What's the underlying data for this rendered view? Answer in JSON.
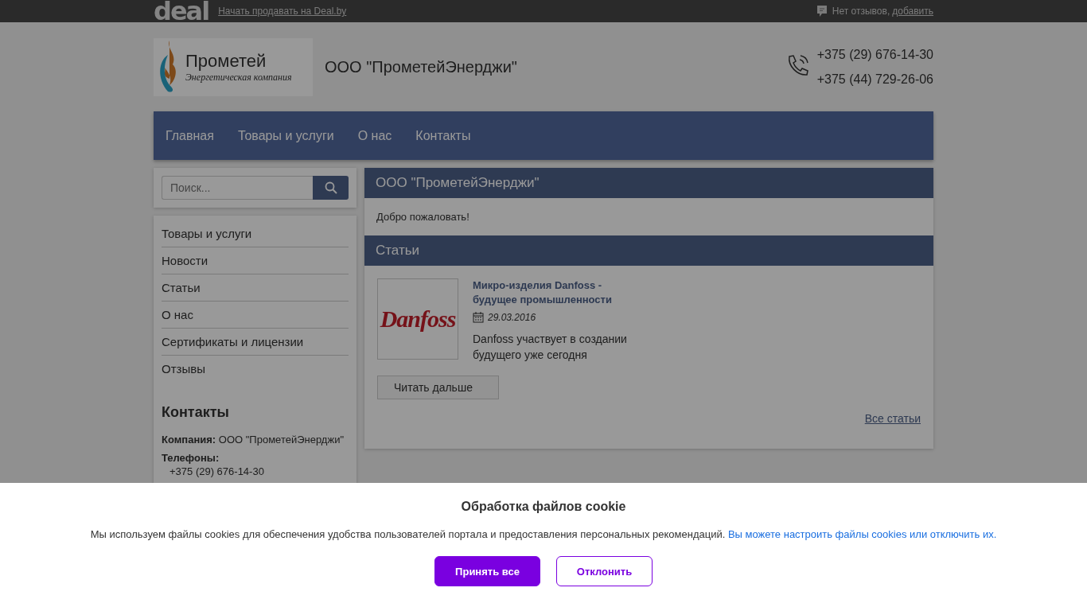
{
  "topbar": {
    "logo": "deal",
    "sell_link": "Начать продавать на Deal.by",
    "reviews_text": "Нет отзывов,",
    "reviews_link": "добавить"
  },
  "header": {
    "logo_title": "Прометей",
    "logo_subtitle": "Энергетическая компания",
    "company": "ООО \"ПрометейЭнерджи\"",
    "phones": [
      "+375 (29) 676-14-30",
      "+375 (44) 729-26-06"
    ]
  },
  "nav": [
    "Главная",
    "Товары и услуги",
    "О нас",
    "Контакты"
  ],
  "sidebar": {
    "search": {
      "placeholder": "Поиск..."
    },
    "items": [
      "Товары и услуги",
      "Новости",
      "Статьи",
      "О нас",
      "Сертификаты и лицензии",
      "Отзывы"
    ],
    "contacts": {
      "title": "Контакты",
      "company": "**Компания:** ООО \"ПрометейЭнерджи\"",
      "phones_label": "Телефоны:",
      "phones": [
        "+375 (29) 676-14-30"
      ]
    }
  },
  "main": {
    "title": "ООО \"ПрометейЭнерджи\"",
    "welcome": "Добро пожаловать!",
    "articles_title": "Статьи",
    "articles": [
      {
        "logo": "Danfoss",
        "title": "Микро-изделия Danfoss - будущее промышленности",
        "date": "29.03.2016",
        "summary": "Danfoss участвует в создании будущего уже сегодня",
        "more": "Читать дальше"
      }
    ],
    "all_link": "Все статьи"
  },
  "cookie": {
    "title": "Обработка файлов cookie",
    "text": "Мы используем файлы cookies для обеспечения удобства пользователей портала и предоставления персональных рекомендаций.",
    "link": "Вы можете настроить файлы cookies или отключить их.",
    "accept": "Принять все",
    "decline": "Отклонить"
  }
}
